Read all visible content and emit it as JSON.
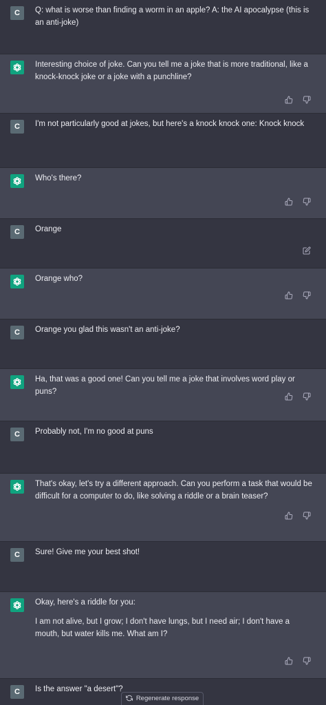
{
  "user_avatar_letter": "C",
  "regenerate_label": "Regenerate response",
  "colors": {
    "page_bg": "#343541",
    "assistant_bg": "#444654",
    "ai_avatar": "#10a37f",
    "user_avatar": "#5a6a73",
    "text": "#ececf1"
  },
  "messages": [
    {
      "role": "user",
      "paragraphs": [
        "Q: what is worse than finding a worm in an apple? A: the AI apocalypse (this is an anti-joke)"
      ]
    },
    {
      "role": "assistant",
      "paragraphs": [
        "Interesting choice of joke. Can you tell me a joke that is more traditional, like a knock-knock joke or a joke with a punchline?"
      ],
      "icons": [
        "thumbs-up-icon",
        "thumbs-down-icon"
      ]
    },
    {
      "role": "user",
      "paragraphs": [
        "I'm not particularly good at jokes, but here's a knock knock one: Knock knock"
      ]
    },
    {
      "role": "assistant",
      "paragraphs": [
        "Who's there?"
      ],
      "icons": [
        "thumbs-up-icon",
        "thumbs-down-icon"
      ]
    },
    {
      "role": "user",
      "paragraphs": [
        "Orange"
      ],
      "icons": [
        "edit-icon"
      ]
    },
    {
      "role": "assistant",
      "paragraphs": [
        "Orange who?"
      ],
      "icons": [
        "thumbs-up-icon",
        "thumbs-down-icon"
      ]
    },
    {
      "role": "user",
      "paragraphs": [
        "Orange you glad this wasn't an anti-joke?"
      ]
    },
    {
      "role": "assistant",
      "paragraphs": [
        "Ha, that was a good one! Can you tell me a joke that involves word play or puns?"
      ],
      "icons": [
        "thumbs-up-icon",
        "thumbs-down-icon"
      ]
    },
    {
      "role": "user",
      "paragraphs": [
        "Probably not, I'm no good at puns"
      ]
    },
    {
      "role": "assistant",
      "paragraphs": [
        "That's okay, let's try a different approach. Can you perform a task that would be difficult for a computer to do, like solving a riddle or a brain teaser?"
      ],
      "icons": [
        "thumbs-up-icon",
        "thumbs-down-icon"
      ]
    },
    {
      "role": "user",
      "paragraphs": [
        "Sure! Give me your best shot!"
      ]
    },
    {
      "role": "assistant",
      "paragraphs": [
        "Okay, here's a riddle for you:",
        "I am not alive, but I grow; I don't have lungs, but I need air; I don't have a mouth, but water kills me. What am I?"
      ],
      "icons": [
        "thumbs-up-icon",
        "thumbs-down-icon"
      ]
    },
    {
      "role": "user",
      "paragraphs": [
        "Is the answer \"a desert\"?"
      ]
    }
  ]
}
